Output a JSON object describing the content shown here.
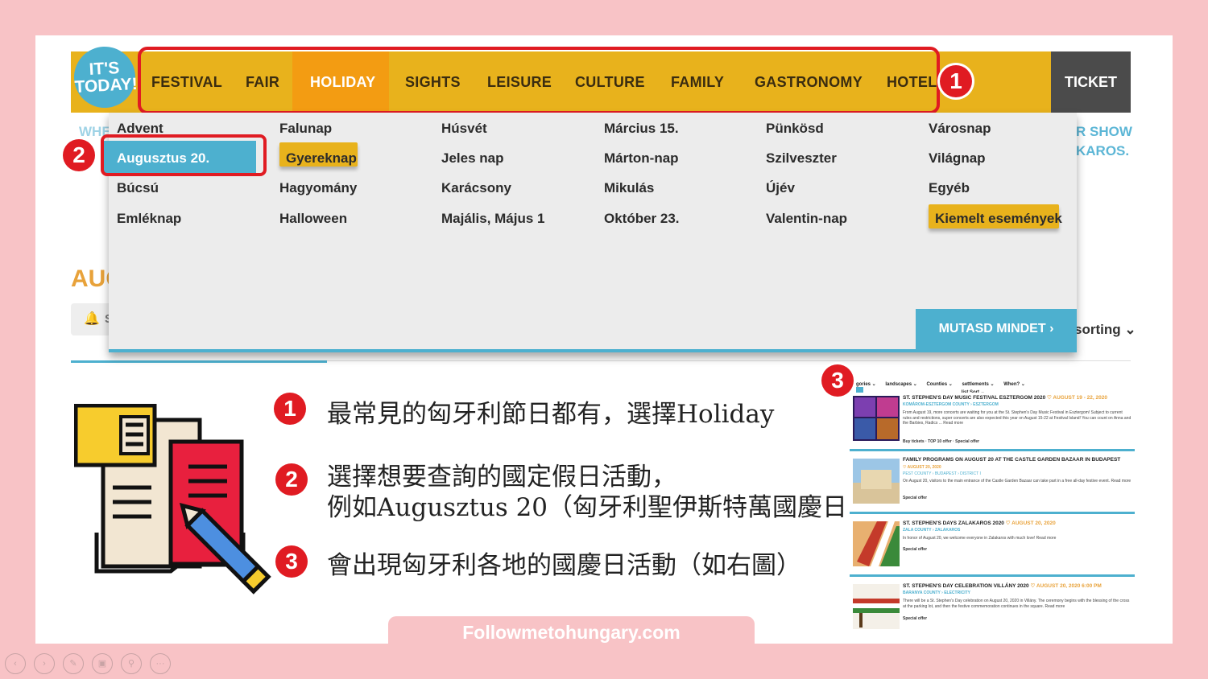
{
  "nav": {
    "logo": {
      "line1": "IT'S",
      "line2": "TODAY!"
    },
    "items": [
      "FESTIVAL",
      "FAIR",
      "HOLIDAY",
      "SIGHTS",
      "LEISURE",
      "CULTURE",
      "FAMILY",
      "GASTRONOMY",
      "HOTEL"
    ],
    "active": "HOLIDAY",
    "ticket": "TICKET"
  },
  "badges": {
    "one": "1",
    "two": "2",
    "three": "3"
  },
  "background": {
    "whe": "WHE",
    "show": "R SHOW",
    "kakaros": "KAROS.",
    "aug": "AUG",
    "bell_s": "S",
    "sorting": "sorting"
  },
  "dropdown": {
    "columns": [
      [
        "Advent",
        "Augusztus 20.",
        "Búcsú",
        "Emléknap"
      ],
      [
        "Falunap",
        "Gyereknap",
        "Hagyomány",
        "Halloween"
      ],
      [
        "Húsvét",
        "Jeles nap",
        "Karácsony",
        "Majális, Május 1"
      ],
      [
        "Március 15.",
        "Márton-nap",
        "Mikulás",
        "Október 23."
      ],
      [
        "Pünkösd",
        "Szilveszter",
        "Újév",
        "Valentin-nap"
      ],
      [
        "Városnap",
        "Világnap",
        "Egyéb",
        "Kiemelt események"
      ]
    ],
    "selected": "Augusztus 20.",
    "button": "MUTASD MINDET"
  },
  "notes": {
    "n1": "最常見的匈牙利節日都有，選擇Holiday",
    "n2a": "選擇想要查詢的國定假日活動，",
    "n2b": "例如Augusztus 20（匈牙利聖伊斯特萬國慶日",
    "n3": "會出現匈牙利各地的國慶日活動（如右圖）"
  },
  "results": {
    "filters": [
      "gories ⌄",
      "landscapes ⌄",
      "Counties ⌄",
      "settlements ⌄",
      "When? ⌄"
    ],
    "sort": "list Sort ⌄",
    "cards": [
      {
        "title": "ST. STEPHEN'S DAY MUSIC FESTIVAL ESZTERGOM 2020",
        "date": "♡ AUGUST 19 - 22, 2020",
        "sub": "KOMÁROM-ESZTERGOM COUNTY  ›  ESZTERGOM",
        "desc": "From August 19, more concerts are waiting for you at the St. Stephen's Day Music Festival in Esztergom! Subject to current rules and restrictions, super concerts are also expected this year on August 15-22 at Festival Island! You can count on Anna and the Barbies, Radics ... Read more",
        "tags": "Buy tickets · TOP 10 offer · Special offer"
      },
      {
        "title": "FAMILY PROGRAMS ON AUGUST 20 AT THE CASTLE GARDEN BAZAAR IN BUDAPEST",
        "date": "♡ AUGUST 20, 2020",
        "sub": "PEST COUNTY  ›  BUDAPEST  ›  DISTRICT I",
        "desc": "On August 20, visitors to the main entrance of the Castle Garden Bazaar can take part in a free all-day festive event. Read more",
        "tags": "Special offer"
      },
      {
        "title": "ST. STEPHEN'S DAYS ZALAKAROS 2020",
        "date": "♡ AUGUST 20, 2020",
        "sub": "ZALA COUNTY  ›  ZALAKAROS",
        "desc": "In honor of August 20, we welcome everyone in Zalakaros with much love! Read more",
        "tags": "Special offer"
      },
      {
        "title": "ST. STEPHEN'S DAY CELEBRATION VILLÁNY 2020",
        "date": "♡ AUGUST 20, 2020 6:00 PM",
        "sub": "BARANYA COUNTY  ›  ELECTRICITY",
        "desc": "There will be a St. Stephen's Day celebration on August 20, 2020 in Villány. The ceremony begins with the blessing of the cross at the parking lot, and then the festive commemoration continues in the square. Read more",
        "tags": "Special offer"
      }
    ]
  },
  "footer": "Followmetohungary.com",
  "colors": {
    "accent_yellow": "#e8b21c",
    "holiday_orange": "#f39c12",
    "blue": "#4db0cf",
    "red": "#e01b22",
    "pink": "#f8c3c6"
  }
}
